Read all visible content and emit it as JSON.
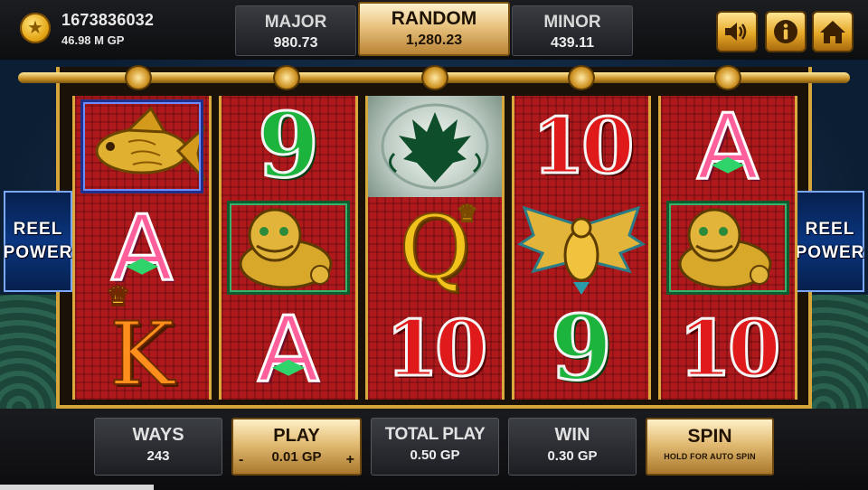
{
  "account": {
    "id": "1673836032",
    "balance": "46.98 M GP",
    "coin_icon": "coin-star-icon"
  },
  "jackpots": {
    "major": {
      "label": "MAJOR",
      "value": "980.73"
    },
    "random": {
      "label": "RANDOM",
      "value": "1,280.23"
    },
    "minor": {
      "label": "MINOR",
      "value": "439.11"
    }
  },
  "top_buttons": {
    "sound_icon": "speaker-icon",
    "info_icon": "info-icon",
    "home_icon": "home-icon"
  },
  "side_banner": {
    "line1": "REEL",
    "line2": "POWER"
  },
  "reels": [
    [
      "goldfish",
      "A",
      "K"
    ],
    [
      "9",
      "foo-dog",
      "A"
    ],
    [
      "dragon",
      "Q",
      "10"
    ],
    [
      "10",
      "phoenix",
      "9"
    ],
    [
      "A",
      "foo-dog",
      "10"
    ]
  ],
  "bottom": {
    "ways": {
      "label": "WAYS",
      "value": "243"
    },
    "play": {
      "label": "PLAY",
      "value": "0.01 GP",
      "minus": "-",
      "plus": "+"
    },
    "total_play": {
      "label": "TOTAL PLAY",
      "value": "0.50 GP"
    },
    "win": {
      "label": "WIN",
      "value": "0.30 GP"
    },
    "spin": {
      "label": "SPIN",
      "sub": "HOLD FOR AUTO SPIN"
    }
  },
  "colors": {
    "gold": "#d6a53a",
    "reel_red": "#b0191c",
    "bar_dark": "#1c1d21",
    "button_gold": "#e2bb73"
  }
}
